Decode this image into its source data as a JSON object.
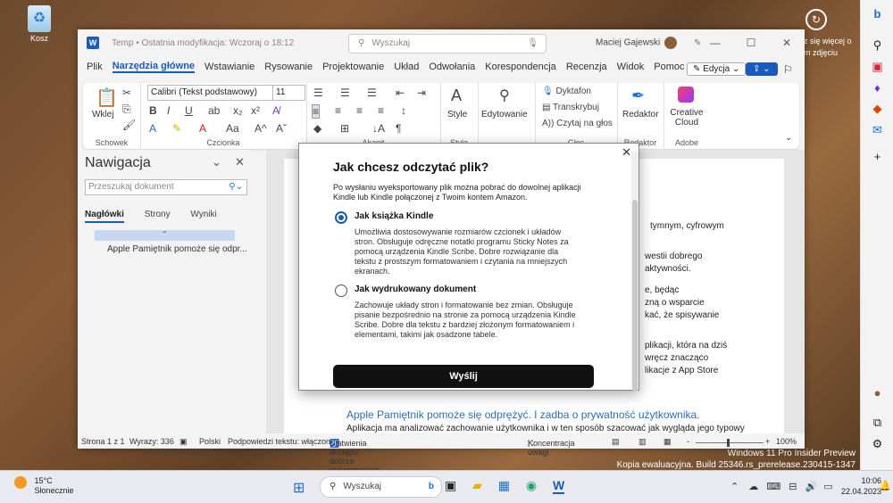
{
  "desktop": {
    "recycle_bin_label": "Kosz",
    "note_lines": [
      "z się więcej o",
      "m zdjęciu"
    ],
    "watermark_line1": "Windows 11 Pro Insider Preview",
    "watermark_line2": "Kopia ewaluacyjna. Build 25346.rs_prerelease.230415-1347"
  },
  "titlebar": {
    "doc_title": "Temp • Ostatnia modyfikacja: Wczoraj o 18:12",
    "search_placeholder": "Wyszukaj",
    "user_name": "Maciej Gajewski"
  },
  "menu": {
    "items": [
      "Plik",
      "Narzędzia główne",
      "Wstawianie",
      "Rysowanie",
      "Projektowanie",
      "Układ",
      "Odwołania",
      "Korespondencja",
      "Recenzja",
      "Widok",
      "Pomoc"
    ],
    "edycja_label": "Edycja"
  },
  "ribbon": {
    "paste_label": "Wklej",
    "font_name": "Calibri (Tekst podstawowy)",
    "font_size": "11",
    "style_label": "Style",
    "edytowanie_label": "Edytowanie",
    "dyktafon": "Dyktafon",
    "transkrybuj": "Transkrybuj",
    "czytaj": "Czytaj na głos",
    "redaktor_label": "Redaktor",
    "creative_cloud": "Creative Cloud",
    "groups": {
      "schowek": "Schowek",
      "czcionka": "Czcionka",
      "akapit": "Akapit",
      "style": "Style",
      "glos": "Głos",
      "redaktor": "Redaktor",
      "adobe": "Adobe"
    }
  },
  "nav": {
    "title": "Nawigacja",
    "search_placeholder": "Przeszukaj dokument",
    "tabs": [
      "Nagłówki",
      "Strony",
      "Wyniki"
    ],
    "heading_item": "Apple Pamiętnik pomoże się odpr..."
  },
  "doc": {
    "frag1": "tymnym, cyfrowym",
    "frag2": "westii dobrego",
    "frag3": "aktywności.",
    "frag4": "e, będąc",
    "frag5": "zną o wsparcie",
    "frag6": "kać, że spisywanie",
    "frag7": "plikacji, która na dziś",
    "frag8": "wręcz znacząco",
    "frag9": "likacje z App Store",
    "heading": "Apple Pamiętnik pomoże się odprężyć. I zadba o prywatność użytkownika.",
    "paragraph": "Aplikacja ma analizować zachowanie użytkownika i w ten sposób szacować jak wygląda jego typowy"
  },
  "dialog": {
    "title": "Jak chcesz odczytać plik?",
    "intro": "Po wysłaniu wyeksportowany plik można pobrać do dowolnej aplikacji Kindle lub Kindle połączonej z Twoim kontem Amazon.",
    "option1_title": "Jak książka Kindle",
    "option1_desc": "Umożliwia dostosowywanie rozmiarów czcionek i układów stron. Obsługuje odręczne notatki programu Sticky Notes za pomocą urządzenia Kindle Scribe. Dobre rozwiązanie dla tekstu z prostszym formatowaniem i czytania na mniejszych ekranach.",
    "option2_title": "Jak wydrukowany dokument",
    "option2_desc": "Zachowuje układy stron i formatowanie bez zmian. Obsługuje pisanie bezpośrednio na stronie za pomocą urządzenia Kindle Scribe. Dobre dla tekstu z bardziej złożonym formatowaniem i elementami, takimi jak osadzone tabele.",
    "send_label": "Wyślij"
  },
  "status": {
    "page": "Strona 1 z 1",
    "words": "Wyrazy: 336",
    "language": "Polski",
    "predictions": "Podpowiedzi tekstu: włączone",
    "accessibility": "Ułatwienia dostępu: dobrze przygotowane",
    "focus": "Koncentracja uwagi",
    "zoom_minus": "-",
    "zoom_plus": "+",
    "zoom": "100%"
  },
  "taskbar": {
    "temperature": "15°C",
    "weather": "Słonecznie",
    "search_label": "Wyszukaj",
    "time": "10:06",
    "date": "22.04.2023"
  }
}
